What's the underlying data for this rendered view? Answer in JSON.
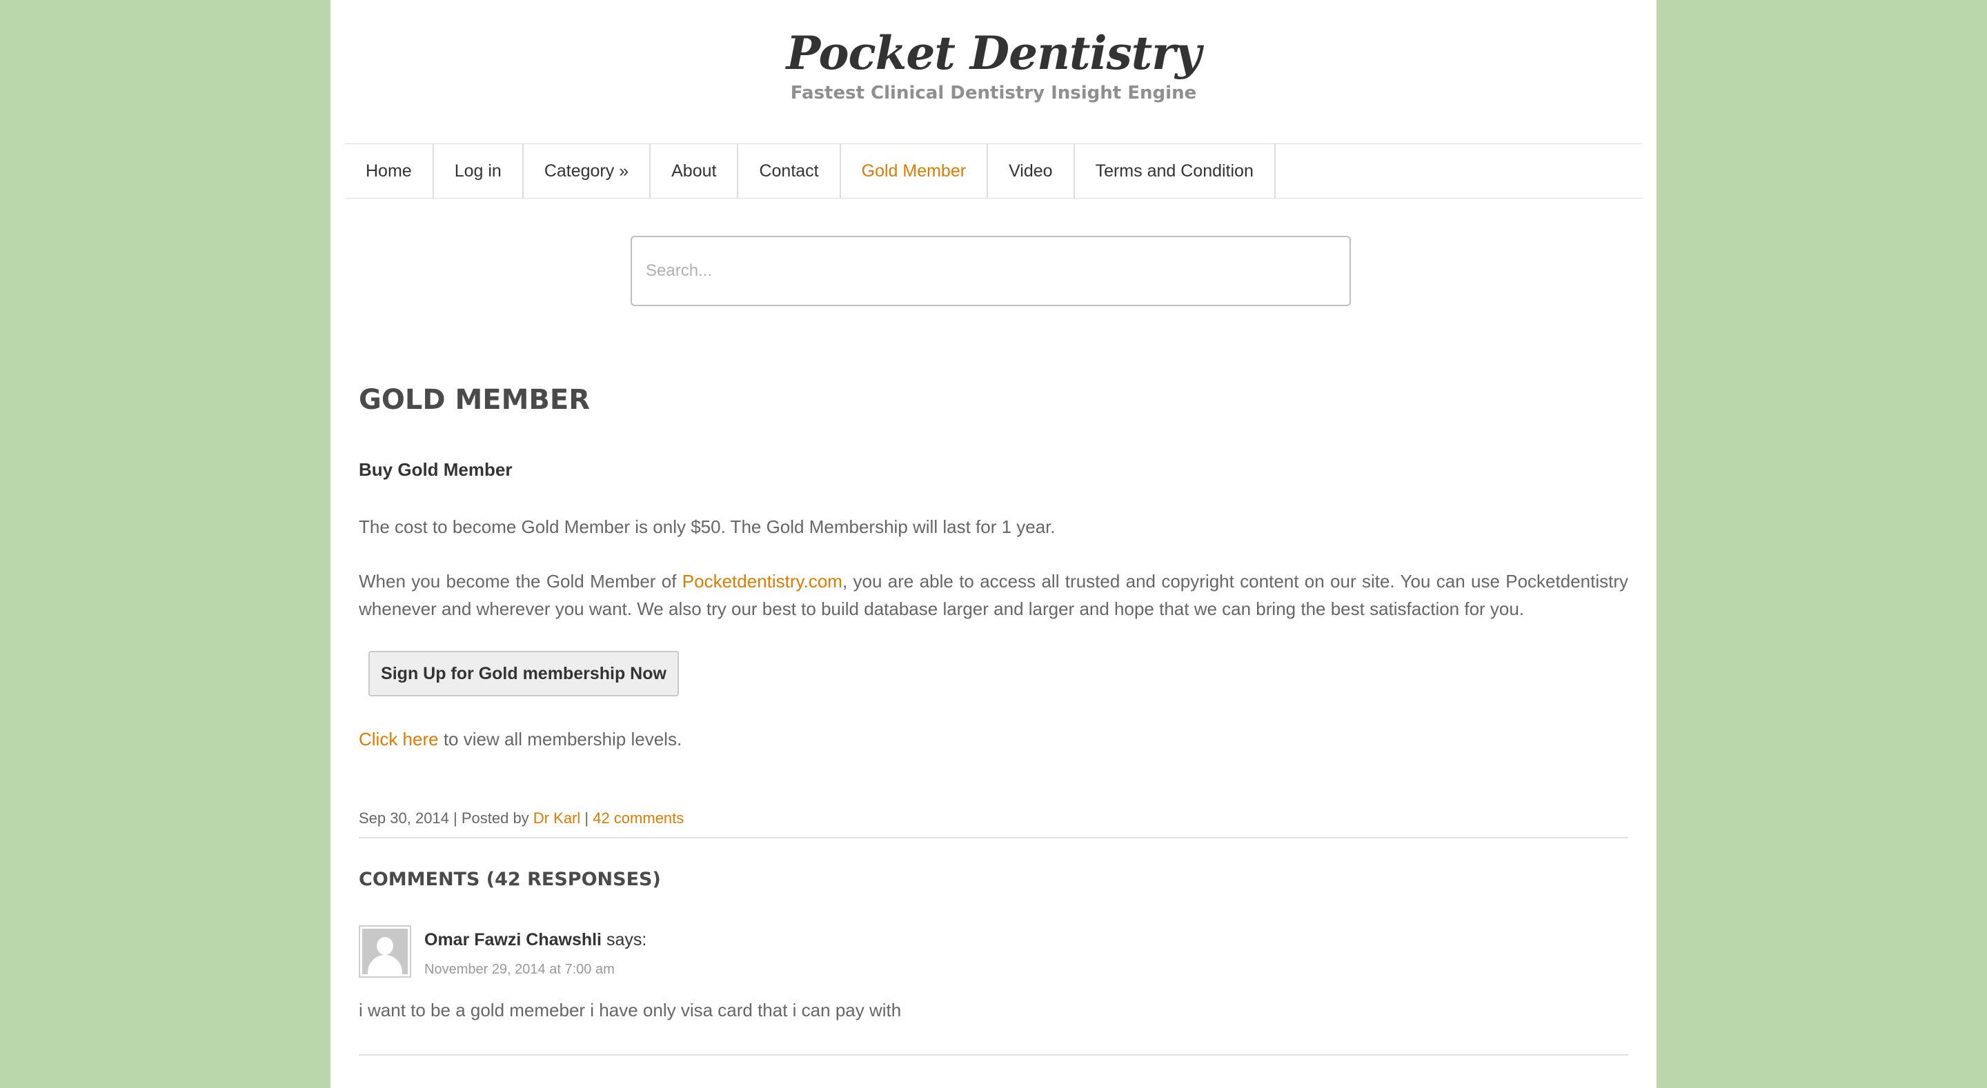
{
  "site": {
    "title": "Pocket Dentistry",
    "tagline": "Fastest Clinical Dentistry Insight Engine"
  },
  "nav": {
    "items": [
      {
        "label": "Home"
      },
      {
        "label": "Log in"
      },
      {
        "label": "Category »"
      },
      {
        "label": "About"
      },
      {
        "label": "Contact"
      },
      {
        "label": "Gold Member"
      },
      {
        "label": "Video"
      },
      {
        "label": "Terms and Condition"
      }
    ],
    "active_index": 5
  },
  "search": {
    "placeholder": "Search..."
  },
  "post": {
    "title": "GOLD MEMBER",
    "subheading": "Buy Gold Member",
    "paragraph1": "The cost to become Gold Member is only $50. The Gold Membership will last for 1 year.",
    "paragraph2_before": "When you become the Gold Member of ",
    "paragraph2_link": "Pocketdentistry.com",
    "paragraph2_after": ", you are able to access all trusted and copyright content on our site. You can use Pocketdentistry whenever and wherever you want. We also try our best to build database larger and larger and hope that we can bring the best satisfaction for you.",
    "signup_button": "Sign Up for Gold membership Now",
    "levels_link": "Click here",
    "levels_text": " to view all membership levels.",
    "meta": {
      "date": "Sep 30, 2014",
      "sep1": " | Posted by ",
      "author": "Dr Karl",
      "sep2": " | ",
      "comments_link": "42 comments"
    }
  },
  "comments": {
    "title": "COMMENTS (42 RESPONSES)",
    "items": [
      {
        "author": "Omar Fawzi Chawshli",
        "says": " says:",
        "date": "November 29, 2014 at 7:00 am",
        "text": "i want to be a gold memeber i have only visa card that i can pay with"
      }
    ]
  },
  "colors": {
    "background": "#b9d7ab",
    "accent": "#e07a00",
    "page": "#ffffff"
  }
}
